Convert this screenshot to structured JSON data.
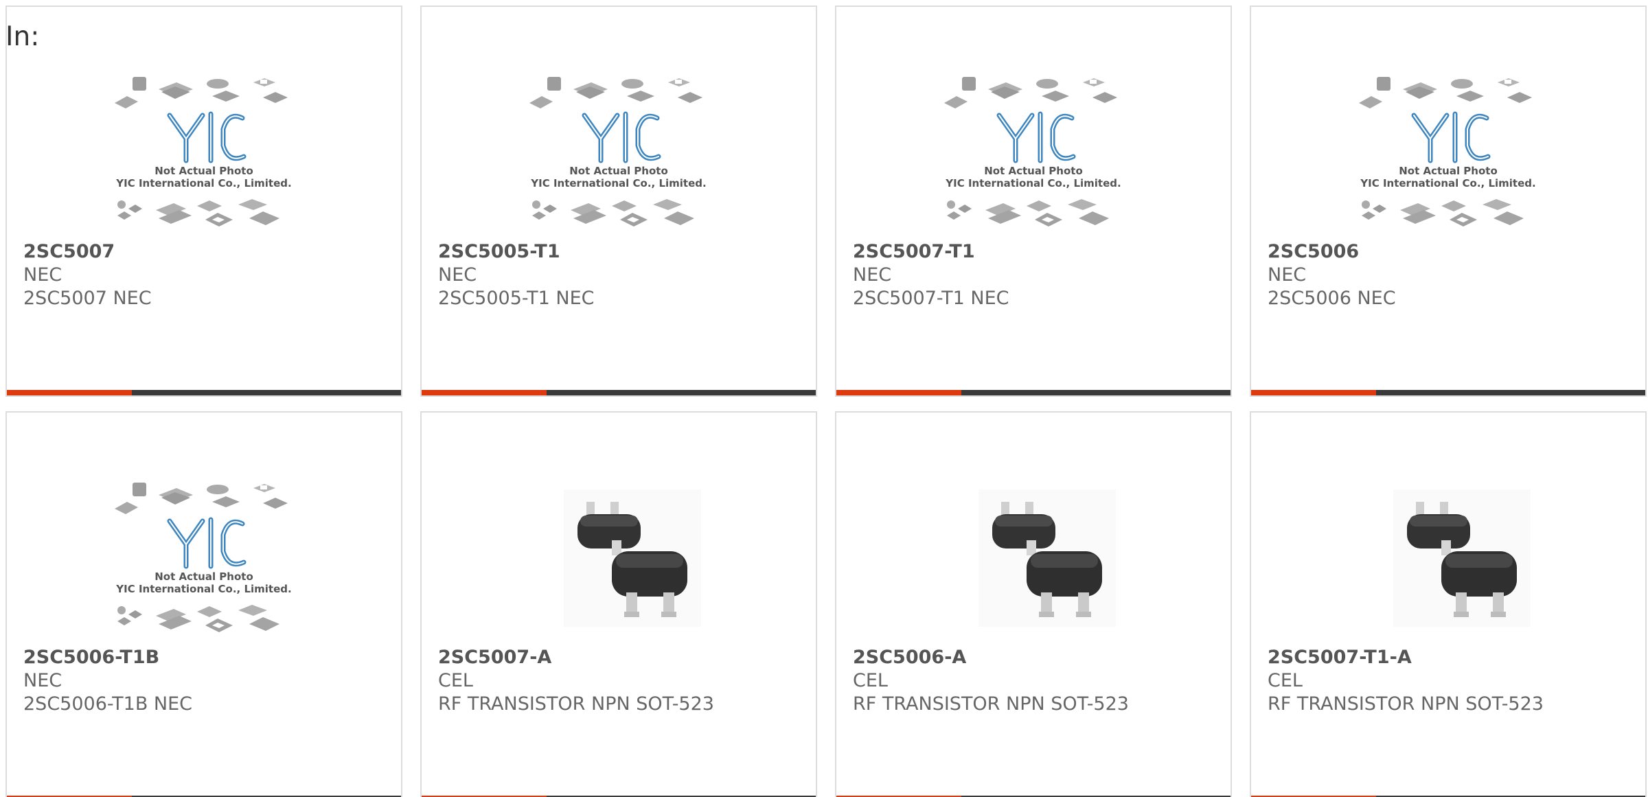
{
  "section": {
    "label": "In:"
  },
  "colors": {
    "accent": "#dd3a10",
    "bar": "#3a3a3a"
  },
  "placeholder_image": {
    "line1": "Not Actual Photo",
    "line2": "YIC International Co., Limited."
  },
  "products": [
    {
      "part": "2SC5007",
      "maker": "NEC",
      "desc": "2SC5007 NEC",
      "image": "placeholder"
    },
    {
      "part": "2SC5005-T1",
      "maker": "NEC",
      "desc": "2SC5005-T1 NEC",
      "image": "placeholder"
    },
    {
      "part": "2SC5007-T1",
      "maker": "NEC",
      "desc": "2SC5007-T1 NEC",
      "image": "placeholder"
    },
    {
      "part": "2SC5006",
      "maker": "NEC",
      "desc": "2SC5006 NEC",
      "image": "placeholder"
    },
    {
      "part": "2SC5006-T1B",
      "maker": "NEC",
      "desc": "2SC5006-T1B NEC",
      "image": "placeholder"
    },
    {
      "part": "2SC5007-A",
      "maker": "CEL",
      "desc": "RF TRANSISTOR NPN SOT-523",
      "image": "sot523"
    },
    {
      "part": "2SC5006-A",
      "maker": "CEL",
      "desc": "RF TRANSISTOR NPN SOT-523",
      "image": "sot523"
    },
    {
      "part": "2SC5007-T1-A",
      "maker": "CEL",
      "desc": "RF TRANSISTOR NPN SOT-523",
      "image": "sot523"
    }
  ]
}
